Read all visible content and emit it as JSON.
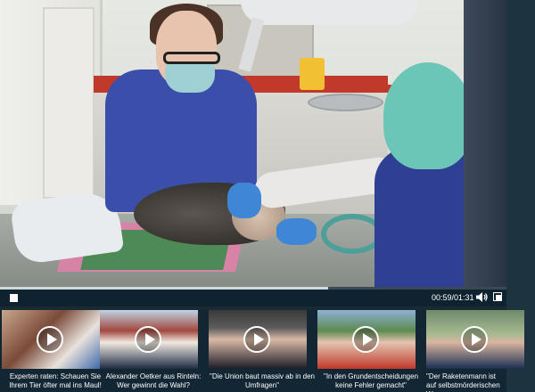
{
  "player": {
    "elapsed": "00:59",
    "duration": "01:31",
    "time_display": "00:59/01:31",
    "progress_fraction": 0.648
  },
  "icons": {
    "stop": "stop-icon",
    "volume": "volume-icon",
    "fullscreen": "fullscreen-icon",
    "play": "play-icon",
    "next": "chevron-right-icon"
  },
  "thumbnails": [
    {
      "title": "Experten raten: Schauen Sie Ihrem Tier öfter mal ins Maul!"
    },
    {
      "title": "Alexander Oetker aus Rinteln: Wer gewinnt die Wahl?"
    },
    {
      "title": "\"Die Union baut massiv ab in den Umfragen\""
    },
    {
      "title": "\"In den Grundentscheidungen keine Fehler gemacht\""
    },
    {
      "title": "\"Der Raketenmann ist auf selbstmörderischen W"
    }
  ],
  "colors": {
    "controls_bg": "#0f2230",
    "strip_bg": "#1d3340",
    "progress_fill": "#cfd8dc"
  }
}
